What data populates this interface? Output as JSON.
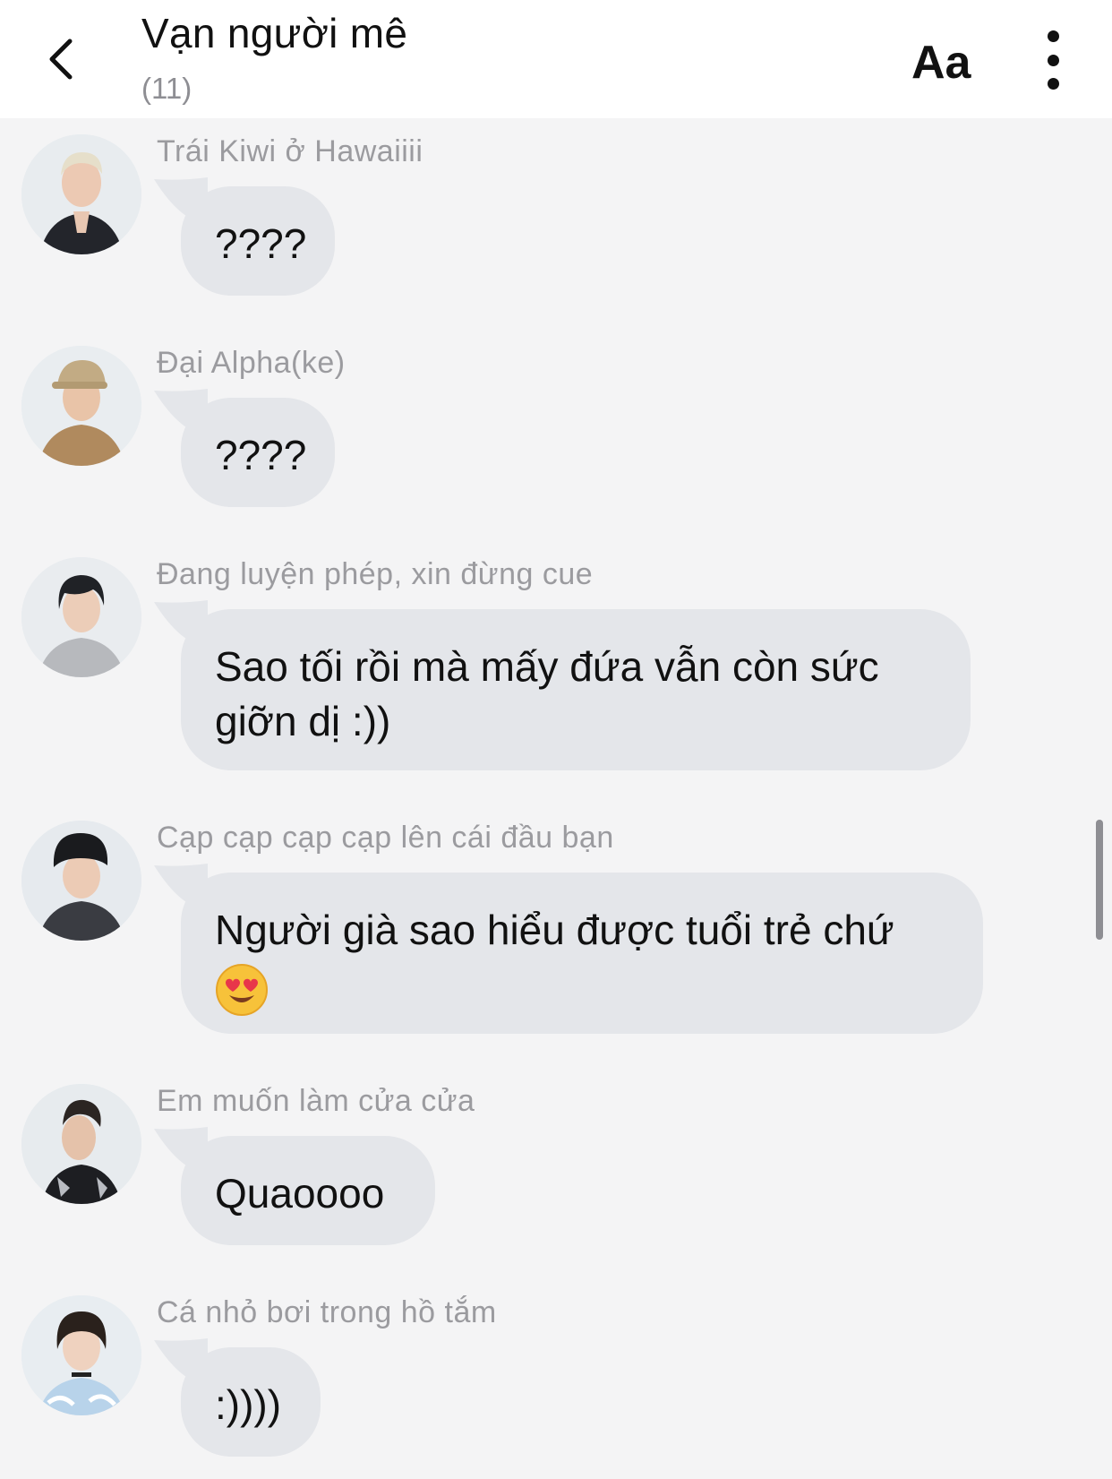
{
  "header": {
    "title": "Vạn người mê",
    "member_count": "(11)",
    "font_button": "Aa",
    "back_icon": "chevron-left-icon",
    "more_icon": "vertical-ellipsis-icon"
  },
  "messages": [
    {
      "sender": "Trái Kiwi ở Hawaiiii",
      "text": "????"
    },
    {
      "sender": "Đại Alpha(ke)",
      "text": "????"
    },
    {
      "sender": "Đang luyện phép, xin đừng cue",
      "text_line1": "Sao tối rồi mà mấy đứa vẫn còn sức",
      "text_line2": "giỡn dị :))"
    },
    {
      "sender": "Cạp cạp cạp cạp lên cái đầu bạn",
      "text_line1": "Người già sao hiểu được tuổi trẻ chứ",
      "emoji": "smiling-face-with-heart-eyes-emoji"
    },
    {
      "sender": "Em muốn làm cửa cửa",
      "text": "Quaoooo"
    },
    {
      "sender": "Cá nhỏ bơi trong hồ tắm",
      "text": ":))))"
    }
  ],
  "colors": {
    "background": "#f4f4f5",
    "bubble": "#e4e6ea",
    "sender_text": "#9b9b9f",
    "header_bg": "#ffffff"
  }
}
